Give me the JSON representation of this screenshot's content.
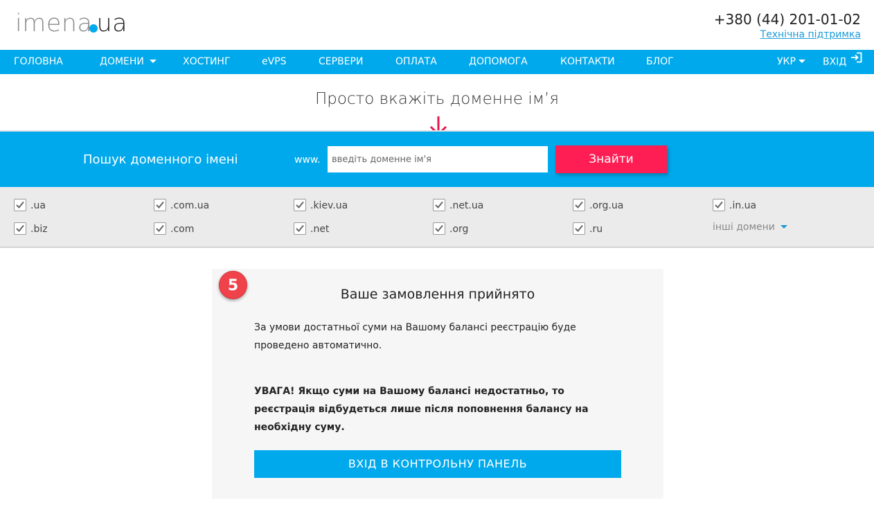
{
  "header": {
    "logo_main": "imena",
    "logo_ua": "ua",
    "phone": "+380 (44) 201-01-02",
    "support_link": "Технічна підтримка"
  },
  "nav": {
    "items": [
      "ГОЛОВНА",
      "ДОМЕНИ",
      "ХОСТИНГ",
      "eVPS",
      "СЕРВЕРИ",
      "ОПЛАТА",
      "ДОПОМОГА",
      "КОНТАКТИ",
      "БЛОГ"
    ],
    "lang": "УКР",
    "login": "ВХІД"
  },
  "tagline": "Просто вкажіть доменне ім’я",
  "search": {
    "label": "Пошук доменного імені",
    "prefix": "www.",
    "placeholder": "введіть доменне ім'я",
    "value": "",
    "button": "Знайти"
  },
  "domains": {
    "row1": [
      ".ua",
      ".com.ua",
      ".kiev.ua",
      ".net.ua",
      ".org.ua",
      ".in.ua"
    ],
    "row2": [
      ".biz",
      ".com",
      ".net",
      ".org",
      ".ru"
    ],
    "all_checked": true,
    "other": "інші домени"
  },
  "order": {
    "step": "5",
    "title": "Ваше замовлення прийнято",
    "text": "За умови достатньої суми на Вашому балансі реєстрацію буде проведено автоматично.",
    "warning": "УВАГА! Якщо суми на Вашому балансі недостатньо, то реєстрація відбудеться лише після поповнення балансу на необхідну суму.",
    "button": "ВХІД В КОНТРОЛЬНУ ПАНЕЛЬ"
  },
  "colors": {
    "brand_blue": "#00a9ec",
    "accent_red": "#ff1e54",
    "badge_red": "#f0424b",
    "link_blue": "#1a9bd7"
  }
}
